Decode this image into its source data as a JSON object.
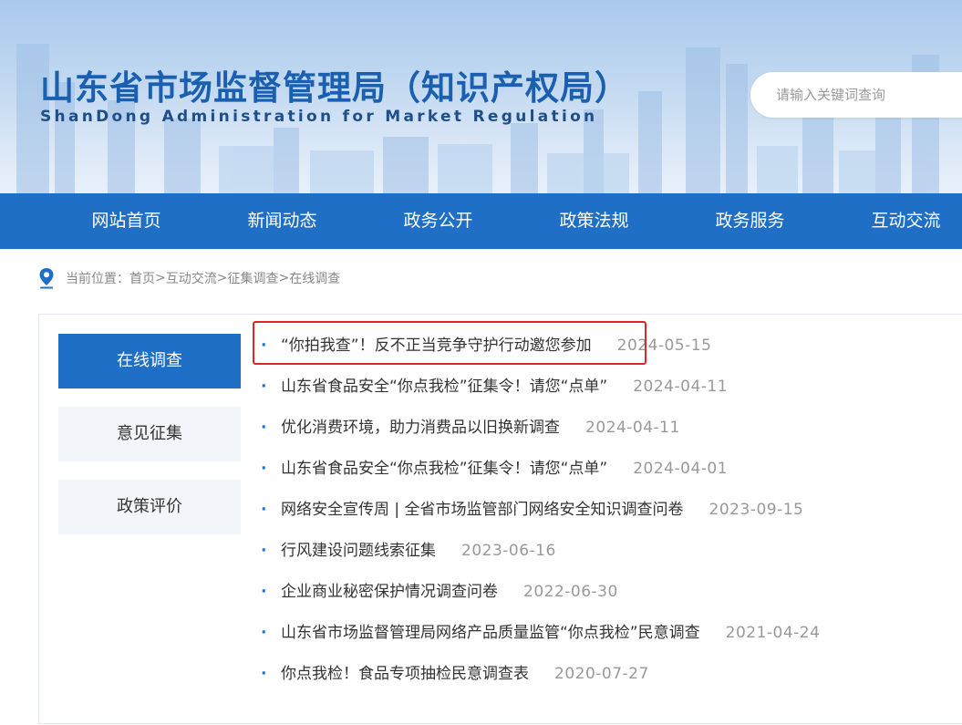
{
  "header": {
    "title": "山东省市场监督管理局（知识产权局）",
    "subtitle": "ShanDong Administration for Market Regulation",
    "search_placeholder": "请输入关键词查询"
  },
  "nav": {
    "items": [
      "网站首页",
      "新闻动态",
      "政务公开",
      "政策法规",
      "政务服务",
      "互动交流"
    ]
  },
  "breadcrumb": {
    "label": "当前位置：",
    "items": [
      "首页",
      "互动交流",
      "征集调查",
      "在线调查"
    ],
    "separator": ">"
  },
  "sidebar": {
    "items": [
      {
        "label": "在线调查",
        "active": true
      },
      {
        "label": "意见征集",
        "active": false
      },
      {
        "label": "政策评价",
        "active": false
      }
    ]
  },
  "list": {
    "bullet": "·",
    "items": [
      {
        "title": "“你拍我查”！反不正当竞争守护行动邀您参加",
        "date": "2024-05-15",
        "highlighted": true
      },
      {
        "title": "山东省食品安全“你点我检”征集令！请您“点单”",
        "date": "2024-04-11"
      },
      {
        "title": "优化消费环境，助力消费品以旧换新调查",
        "date": "2024-04-11"
      },
      {
        "title": "山东省食品安全“你点我检”征集令！请您“点单”",
        "date": "2024-04-01"
      },
      {
        "title": "网络安全宣传周 | 全省市场监管部门网络安全知识调查问卷",
        "date": "2023-09-15"
      },
      {
        "title": "行风建设问题线索征集",
        "date": "2023-06-16"
      },
      {
        "title": "企业商业秘密保护情况调查问卷",
        "date": "2022-06-30"
      },
      {
        "title": "山东省市场监督管理局网络产品质量监管“你点我检”民意调查",
        "date": "2021-04-24"
      },
      {
        "title": "你点我检！食品专项抽检民意调查表",
        "date": "2020-07-27"
      }
    ]
  },
  "colors": {
    "primary_blue": "#1f6fc7",
    "title_blue": "#1a5fb0",
    "highlight_red": "#e0262a",
    "date_gray": "#999999"
  },
  "icons": {
    "breadcrumb_icon": "location-pin-icon"
  }
}
